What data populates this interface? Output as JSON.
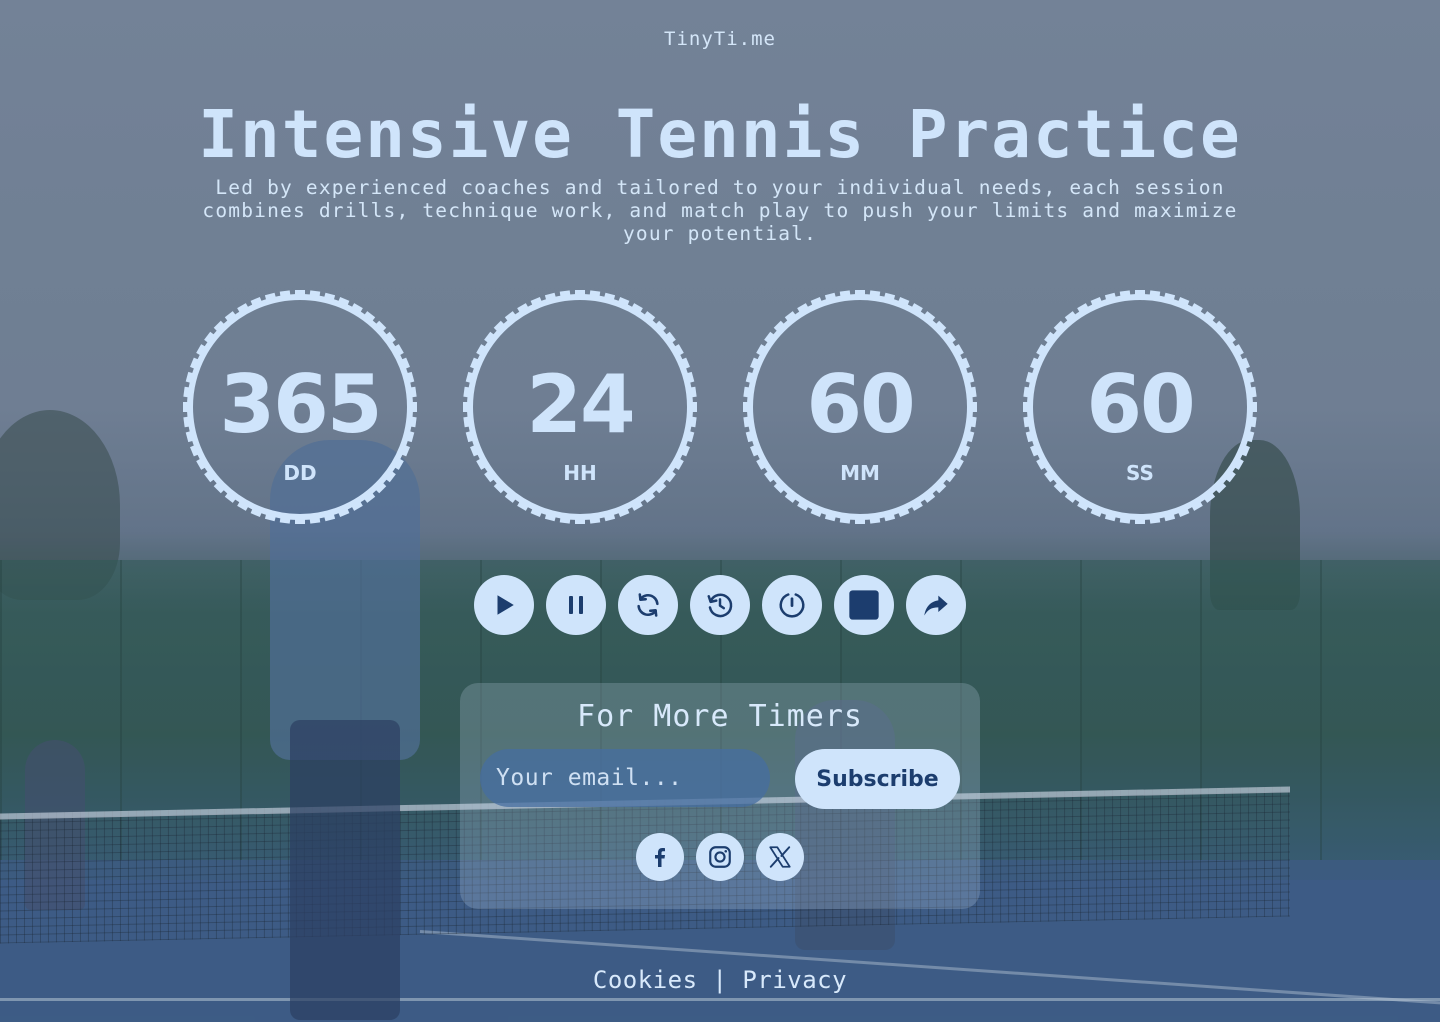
{
  "brand": "TinyTi.me",
  "hero": {
    "title": "Intensive Tennis Practice",
    "subtitle": "Led by experienced coaches and tailored to your individual needs, each session combines drills, technique work, and match play to push your limits and maximize your potential."
  },
  "timers": [
    {
      "value": "365",
      "unit": "DD"
    },
    {
      "value": "24",
      "unit": "HH"
    },
    {
      "value": "60",
      "unit": "MM"
    },
    {
      "value": "60",
      "unit": "SS"
    }
  ],
  "controls": [
    {
      "name": "play-icon"
    },
    {
      "name": "pause-icon"
    },
    {
      "name": "refresh-icon"
    },
    {
      "name": "history-icon"
    },
    {
      "name": "timer-reset-icon"
    },
    {
      "name": "stop-icon"
    },
    {
      "name": "share-icon"
    }
  ],
  "subscribe": {
    "title": "For More Timers",
    "email_placeholder": "Your email...",
    "button_label": "Subscribe"
  },
  "social": [
    {
      "name": "facebook-icon"
    },
    {
      "name": "instagram-icon"
    },
    {
      "name": "x-icon"
    }
  ],
  "footer": {
    "cookies": "Cookies",
    "separator": "|",
    "privacy": "Privacy"
  },
  "colors": {
    "accent": "#cfe4fb",
    "accent_dark": "#1c3d6e"
  }
}
